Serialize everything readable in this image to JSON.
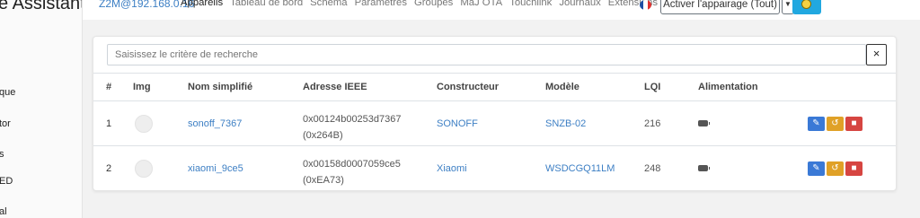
{
  "sidebar": {
    "title": "e Assistant",
    "items": [
      {
        "label": "que"
      },
      {
        "label": "tor"
      },
      {
        "label": "s"
      },
      {
        "label": "ED"
      },
      {
        "label": "al"
      }
    ]
  },
  "nav": {
    "brand": "Z2M@192.168.0.16",
    "links": [
      "Appareils",
      "Tableau de bord",
      "Schéma",
      "Paramètres",
      "Groupes",
      "MàJ OTA",
      "Touchlink",
      "Journaux",
      "Extensions"
    ],
    "active_link": "Appareils",
    "join_button_label": "Activer l'appairage (Tout)",
    "join_dropdown_icon": "chevron-down-icon",
    "permit_icon": "smile-icon",
    "flag_colors": [
      "#1f4fa3",
      "#ffffff",
      "#e0312f"
    ]
  },
  "search": {
    "placeholder": "Saisissez le critère de recherche",
    "clear_label": "×"
  },
  "table": {
    "headers": [
      "#",
      "Img",
      "Nom simplifié",
      "Adresse IEEE",
      "Constructeur",
      "Modèle",
      "LQI",
      "Alimentation"
    ],
    "rows": [
      {
        "num": "1",
        "name": "sonoff_7367",
        "ieee": "0x00124b00253d7367",
        "ieee_short": "(0x264B)",
        "vendor": "SONOFF",
        "model": "SNZB-02",
        "lqi": "216",
        "power_icon": "battery-icon"
      },
      {
        "num": "2",
        "name": "xiaomi_9ce5",
        "ieee": "0x00158d0007059ce5",
        "ieee_short": "(0xEA73)",
        "vendor": "Xiaomi",
        "model": "WSDCGQ11LM",
        "lqi": "248",
        "power_icon": "battery-icon"
      }
    ],
    "action_icons": [
      "edit-icon",
      "rename-icon",
      "trash-icon"
    ]
  },
  "colors": {
    "link": "#3d7fc4",
    "edit": "#3a79d6",
    "rename": "#e0a127",
    "delete": "#d64541",
    "permit": "#21a8e0"
  }
}
